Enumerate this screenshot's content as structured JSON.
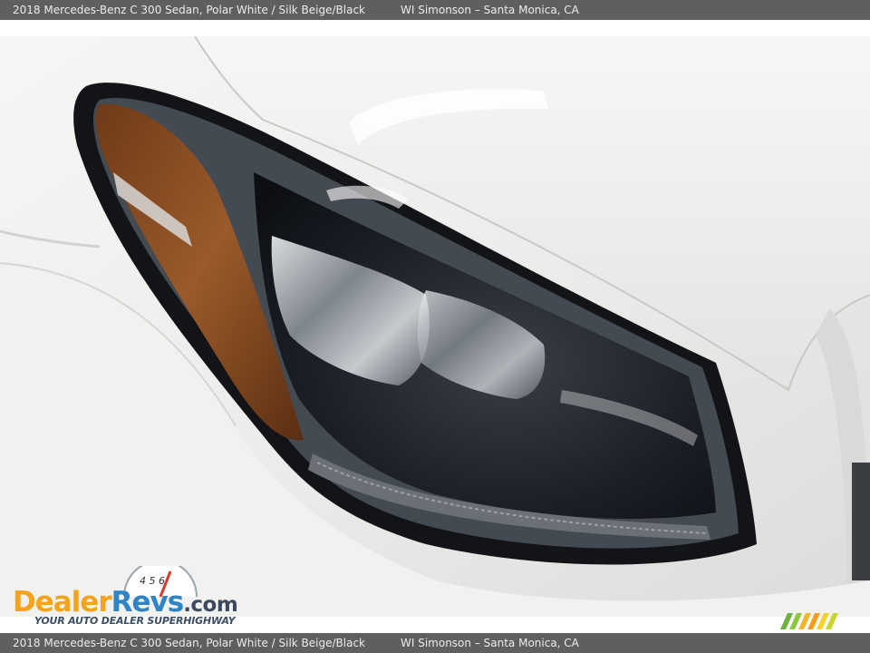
{
  "header": {
    "vehicle": "2018 Mercedes-Benz C 300 Sedan,  Polar White / Silk Beige/Black",
    "dealer": "WI Simonson – Santa Monica, CA"
  },
  "footer": {
    "vehicle": "2018 Mercedes-Benz C 300 Sedan,  Polar White / Silk Beige/Black",
    "dealer": "WI Simonson – Santa Monica, CA"
  },
  "watermark": {
    "brand_dealer": "Dealer",
    "brand_revs": "Revs",
    "brand_com": ".com",
    "tagline": "YOUR AUTO DEALER SUPERHIGHWAY",
    "gauge_digits": "4 5 6"
  },
  "colors": {
    "bar": "#5f5f61",
    "paint": "#eeeeec",
    "amber_lens": "#8a4a1e",
    "logo_orange": "#f3a31c",
    "logo_blue": "#2f84c6"
  }
}
